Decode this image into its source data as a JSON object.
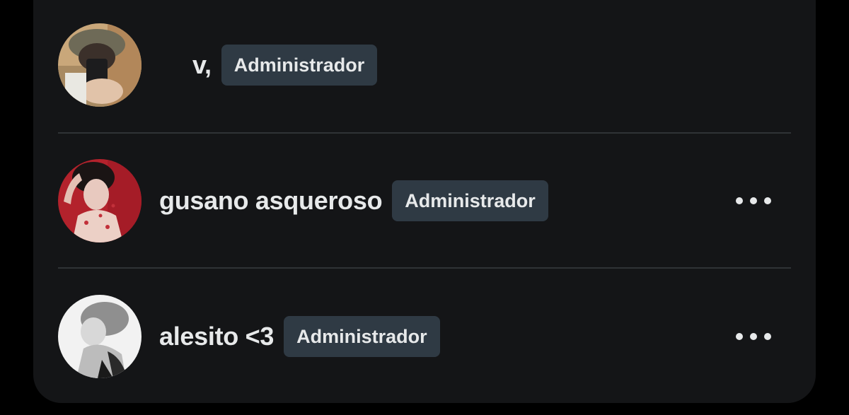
{
  "members": [
    {
      "name": "v,",
      "role": "Administrador",
      "avatar_icon": "user-photo-mirror-selfie",
      "has_menu": false
    },
    {
      "name": "gusano asqueroso",
      "role": "Administrador",
      "avatar_icon": "user-photo-red-background",
      "has_menu": true,
      "menu_icon": "more-horizontal-icon"
    },
    {
      "name": "alesito <3",
      "role": "Administrador",
      "avatar_icon": "user-photo-grayscale",
      "has_menu": true,
      "menu_icon": "more-horizontal-icon"
    }
  ],
  "colors": {
    "page_background": "#000000",
    "panel_background": "#141517",
    "text_primary": "#e7e9ea",
    "badge_background": "#2f3a44",
    "divider": "#2f3336"
  }
}
